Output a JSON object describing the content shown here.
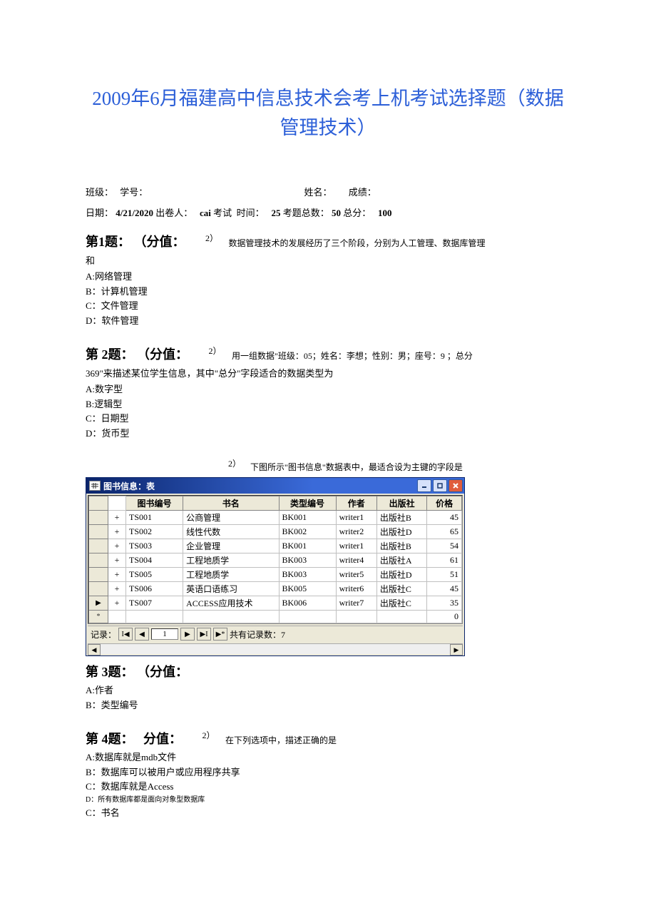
{
  "title": "2009年6月福建高中信息技术会考上机考试选择题（数据管理技术）",
  "info": {
    "class_label": "班级：",
    "id_label": "学号：",
    "name_label": "姓名：",
    "score_label": "成绩："
  },
  "dateline": {
    "date_label": "日期：",
    "date_value": "4/21/2020",
    "setter_label": "出卷人：",
    "setter_value": "cai",
    "exam_label": "考试",
    "time_label": "时间：",
    "time_value": "25",
    "count_label": "考题总数：",
    "count_value": "50",
    "total_label": "总分：",
    "total_value": "100"
  },
  "q1": {
    "header": "第1题：",
    "score_label": "（分值：",
    "score_sup": "2）",
    "text_inline": "数据管理技术的发展经历了三个阶段，分别为人工管理、数据库管理",
    "tail": "和",
    "opt_a": "A:网络管理",
    "opt_b": "B：计算机管理",
    "opt_c": "C：文件管理",
    "opt_d": "D：软件管理"
  },
  "q2": {
    "header": "第 2题：",
    "score_label": "（分值：",
    "score_sup": "2）",
    "text_inline": "用一组数据\"班级：05；姓名：李想；性别：男；座号：9 ；总分",
    "tail": "369\"来描述某位学生信息，其中\"总分\"字段适合的数据类型为",
    "opt_a": "A:数字型",
    "opt_b": "B:逻辑型",
    "opt_c": "C：日期型",
    "opt_d": "D：货币型"
  },
  "q3_caption_sup": "2）",
  "q3_caption_text": "下图所示\"图书信息\"数据表中，最适合设为主键的字段是",
  "access": {
    "window_title": "图书信息：表",
    "table": {
      "headers": [
        "图书编号",
        "书名",
        "类型编号",
        "作者",
        "出版社",
        "价格"
      ],
      "rows": [
        {
          "id": "TS001",
          "name": "公商管理",
          "type": "BK001",
          "author": "writer1",
          "pub": "出版社B",
          "price": "45"
        },
        {
          "id": "TS002",
          "name": "线性代数",
          "type": "BK002",
          "author": "writer2",
          "pub": "出版社D",
          "price": "65"
        },
        {
          "id": "TS003",
          "name": "企业管理",
          "type": "BK001",
          "author": "writer1",
          "pub": "出版社B",
          "price": "54"
        },
        {
          "id": "TS004",
          "name": "工程地质学",
          "type": "BK003",
          "author": "writer4",
          "pub": "出版社A",
          "price": "61"
        },
        {
          "id": "TS005",
          "name": "工程地质学",
          "type": "BK003",
          "author": "writer5",
          "pub": "出版社D",
          "price": "51"
        },
        {
          "id": "TS006",
          "name": "英语口语练习",
          "type": "BK005",
          "author": "writer6",
          "pub": "出版社C",
          "price": "45"
        },
        {
          "id": "TS007",
          "name": "ACCESS应用技术",
          "type": "BK006",
          "author": "writer7",
          "pub": "出版社C",
          "price": "35"
        }
      ],
      "new_row_price": "0"
    },
    "nav": {
      "label": "记录：",
      "current": "1",
      "count_label": "共有记录数：7"
    }
  },
  "q3": {
    "header": "第 3题：",
    "score_label": "（分值：",
    "opt_a": "A:作者",
    "opt_b": "B：类型编号"
  },
  "q4": {
    "header": "第 4题：",
    "score_label": "分值：",
    "score_sup": "2）",
    "text_inline": "在下列选项中，描述正确的是",
    "opt_a": "A:数据库就是mdb文件",
    "opt_b": "B：数据库可以被用户或应用程序共享",
    "opt_c": "C：数据库就是Access",
    "opt_d": "D：所有数据库都是面向对象型数据库",
    "extra": "C：书名"
  }
}
